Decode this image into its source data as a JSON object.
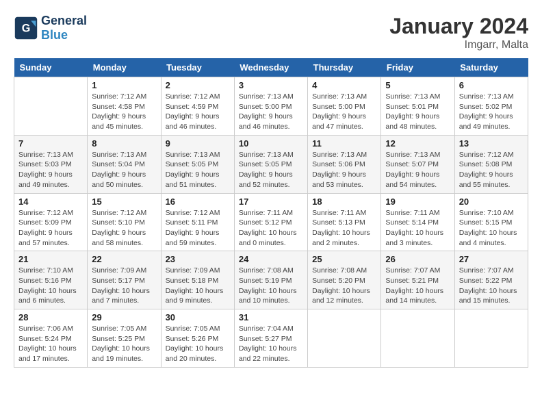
{
  "header": {
    "logo_text_general": "General",
    "logo_text_blue": "Blue",
    "month_title": "January 2024",
    "location": "Imgarr, Malta"
  },
  "weekdays": [
    "Sunday",
    "Monday",
    "Tuesday",
    "Wednesday",
    "Thursday",
    "Friday",
    "Saturday"
  ],
  "weeks": [
    [
      {
        "day": "",
        "sunrise": "",
        "sunset": "",
        "daylight": ""
      },
      {
        "day": "1",
        "sunrise": "Sunrise: 7:12 AM",
        "sunset": "Sunset: 4:58 PM",
        "daylight": "Daylight: 9 hours and 45 minutes."
      },
      {
        "day": "2",
        "sunrise": "Sunrise: 7:12 AM",
        "sunset": "Sunset: 4:59 PM",
        "daylight": "Daylight: 9 hours and 46 minutes."
      },
      {
        "day": "3",
        "sunrise": "Sunrise: 7:13 AM",
        "sunset": "Sunset: 5:00 PM",
        "daylight": "Daylight: 9 hours and 46 minutes."
      },
      {
        "day": "4",
        "sunrise": "Sunrise: 7:13 AM",
        "sunset": "Sunset: 5:00 PM",
        "daylight": "Daylight: 9 hours and 47 minutes."
      },
      {
        "day": "5",
        "sunrise": "Sunrise: 7:13 AM",
        "sunset": "Sunset: 5:01 PM",
        "daylight": "Daylight: 9 hours and 48 minutes."
      },
      {
        "day": "6",
        "sunrise": "Sunrise: 7:13 AM",
        "sunset": "Sunset: 5:02 PM",
        "daylight": "Daylight: 9 hours and 49 minutes."
      }
    ],
    [
      {
        "day": "7",
        "sunrise": "Sunrise: 7:13 AM",
        "sunset": "Sunset: 5:03 PM",
        "daylight": "Daylight: 9 hours and 49 minutes."
      },
      {
        "day": "8",
        "sunrise": "Sunrise: 7:13 AM",
        "sunset": "Sunset: 5:04 PM",
        "daylight": "Daylight: 9 hours and 50 minutes."
      },
      {
        "day": "9",
        "sunrise": "Sunrise: 7:13 AM",
        "sunset": "Sunset: 5:05 PM",
        "daylight": "Daylight: 9 hours and 51 minutes."
      },
      {
        "day": "10",
        "sunrise": "Sunrise: 7:13 AM",
        "sunset": "Sunset: 5:05 PM",
        "daylight": "Daylight: 9 hours and 52 minutes."
      },
      {
        "day": "11",
        "sunrise": "Sunrise: 7:13 AM",
        "sunset": "Sunset: 5:06 PM",
        "daylight": "Daylight: 9 hours and 53 minutes."
      },
      {
        "day": "12",
        "sunrise": "Sunrise: 7:13 AM",
        "sunset": "Sunset: 5:07 PM",
        "daylight": "Daylight: 9 hours and 54 minutes."
      },
      {
        "day": "13",
        "sunrise": "Sunrise: 7:12 AM",
        "sunset": "Sunset: 5:08 PM",
        "daylight": "Daylight: 9 hours and 55 minutes."
      }
    ],
    [
      {
        "day": "14",
        "sunrise": "Sunrise: 7:12 AM",
        "sunset": "Sunset: 5:09 PM",
        "daylight": "Daylight: 9 hours and 57 minutes."
      },
      {
        "day": "15",
        "sunrise": "Sunrise: 7:12 AM",
        "sunset": "Sunset: 5:10 PM",
        "daylight": "Daylight: 9 hours and 58 minutes."
      },
      {
        "day": "16",
        "sunrise": "Sunrise: 7:12 AM",
        "sunset": "Sunset: 5:11 PM",
        "daylight": "Daylight: 9 hours and 59 minutes."
      },
      {
        "day": "17",
        "sunrise": "Sunrise: 7:11 AM",
        "sunset": "Sunset: 5:12 PM",
        "daylight": "Daylight: 10 hours and 0 minutes."
      },
      {
        "day": "18",
        "sunrise": "Sunrise: 7:11 AM",
        "sunset": "Sunset: 5:13 PM",
        "daylight": "Daylight: 10 hours and 2 minutes."
      },
      {
        "day": "19",
        "sunrise": "Sunrise: 7:11 AM",
        "sunset": "Sunset: 5:14 PM",
        "daylight": "Daylight: 10 hours and 3 minutes."
      },
      {
        "day": "20",
        "sunrise": "Sunrise: 7:10 AM",
        "sunset": "Sunset: 5:15 PM",
        "daylight": "Daylight: 10 hours and 4 minutes."
      }
    ],
    [
      {
        "day": "21",
        "sunrise": "Sunrise: 7:10 AM",
        "sunset": "Sunset: 5:16 PM",
        "daylight": "Daylight: 10 hours and 6 minutes."
      },
      {
        "day": "22",
        "sunrise": "Sunrise: 7:09 AM",
        "sunset": "Sunset: 5:17 PM",
        "daylight": "Daylight: 10 hours and 7 minutes."
      },
      {
        "day": "23",
        "sunrise": "Sunrise: 7:09 AM",
        "sunset": "Sunset: 5:18 PM",
        "daylight": "Daylight: 10 hours and 9 minutes."
      },
      {
        "day": "24",
        "sunrise": "Sunrise: 7:08 AM",
        "sunset": "Sunset: 5:19 PM",
        "daylight": "Daylight: 10 hours and 10 minutes."
      },
      {
        "day": "25",
        "sunrise": "Sunrise: 7:08 AM",
        "sunset": "Sunset: 5:20 PM",
        "daylight": "Daylight: 10 hours and 12 minutes."
      },
      {
        "day": "26",
        "sunrise": "Sunrise: 7:07 AM",
        "sunset": "Sunset: 5:21 PM",
        "daylight": "Daylight: 10 hours and 14 minutes."
      },
      {
        "day": "27",
        "sunrise": "Sunrise: 7:07 AM",
        "sunset": "Sunset: 5:22 PM",
        "daylight": "Daylight: 10 hours and 15 minutes."
      }
    ],
    [
      {
        "day": "28",
        "sunrise": "Sunrise: 7:06 AM",
        "sunset": "Sunset: 5:24 PM",
        "daylight": "Daylight: 10 hours and 17 minutes."
      },
      {
        "day": "29",
        "sunrise": "Sunrise: 7:05 AM",
        "sunset": "Sunset: 5:25 PM",
        "daylight": "Daylight: 10 hours and 19 minutes."
      },
      {
        "day": "30",
        "sunrise": "Sunrise: 7:05 AM",
        "sunset": "Sunset: 5:26 PM",
        "daylight": "Daylight: 10 hours and 20 minutes."
      },
      {
        "day": "31",
        "sunrise": "Sunrise: 7:04 AM",
        "sunset": "Sunset: 5:27 PM",
        "daylight": "Daylight: 10 hours and 22 minutes."
      },
      {
        "day": "",
        "sunrise": "",
        "sunset": "",
        "daylight": ""
      },
      {
        "day": "",
        "sunrise": "",
        "sunset": "",
        "daylight": ""
      },
      {
        "day": "",
        "sunrise": "",
        "sunset": "",
        "daylight": ""
      }
    ]
  ]
}
